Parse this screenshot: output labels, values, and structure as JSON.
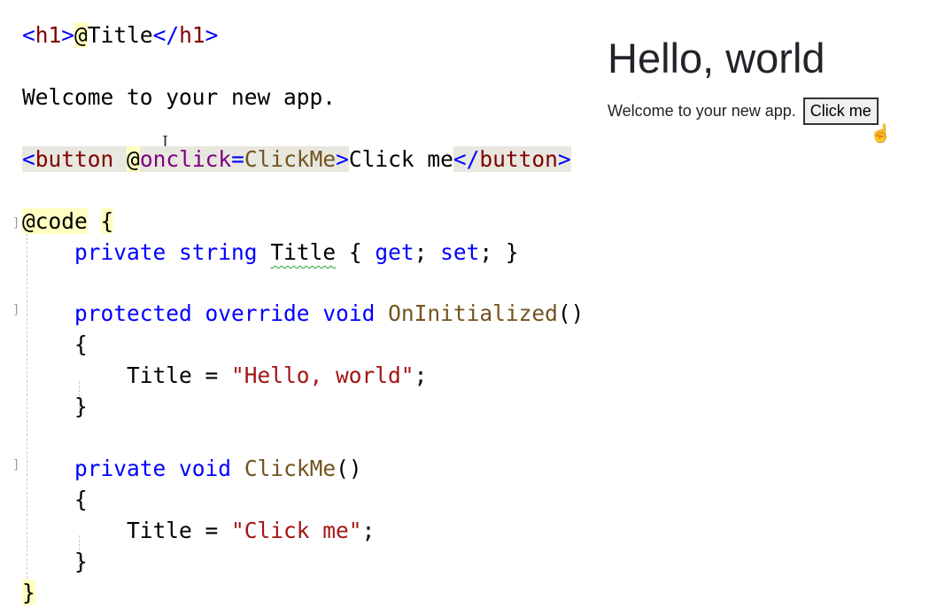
{
  "editor": {
    "lines": {
      "l1": {
        "open_tag": "<",
        "tag1": "h1",
        "close1": ">",
        "razor_at": "@",
        "expr": "Title",
        "end_open": "</",
        "tag2": "h1",
        "end_close": ">"
      },
      "l2": {
        "text": "Welcome to your new app."
      },
      "l3": {
        "lt": "<",
        "tag": "button",
        "space": " ",
        "at": "@",
        "attr": "onclick",
        "eq": "=",
        "handler": "ClickMe",
        "gt": ">",
        "content": "Click me",
        "end_lt": "</",
        "end_tag": "button",
        "end_gt": ">"
      },
      "l4": {
        "directive": "@code",
        "space": " ",
        "brace": "{"
      },
      "l5": {
        "indent": "    ",
        "kw1": "private",
        "kw2": "string",
        "prop": "Title",
        "brace_open": " { ",
        "get": "get",
        "semi1": "; ",
        "set": "set",
        "semi2": "; }"
      },
      "l6": {
        "indent": "    ",
        "kw1": "protected",
        "kw2": "override",
        "kw3": "void",
        "method": "OnInitialized",
        "parens": "()"
      },
      "l7": {
        "text": "    {"
      },
      "l8": {
        "indent": "        ",
        "ident": "Title",
        "op": " = ",
        "str": "\"Hello, world\"",
        "semi": ";"
      },
      "l9": {
        "text": "    }"
      },
      "l10": {
        "indent": "    ",
        "kw1": "private",
        "kw2": "void",
        "method": "ClickMe",
        "parens": "()"
      },
      "l11": {
        "text": "    {"
      },
      "l12": {
        "indent": "        ",
        "ident": "Title",
        "op": " = ",
        "str": "\"Click me\"",
        "semi": ";"
      },
      "l13": {
        "text": "    }"
      },
      "l14": {
        "text": "}"
      }
    },
    "ibeam_icon": "I-beam cursor"
  },
  "preview": {
    "heading": "Hello, world",
    "paragraph": "Welcome to your new app.",
    "button_label": "Click me",
    "cursor_icon": "☝"
  }
}
